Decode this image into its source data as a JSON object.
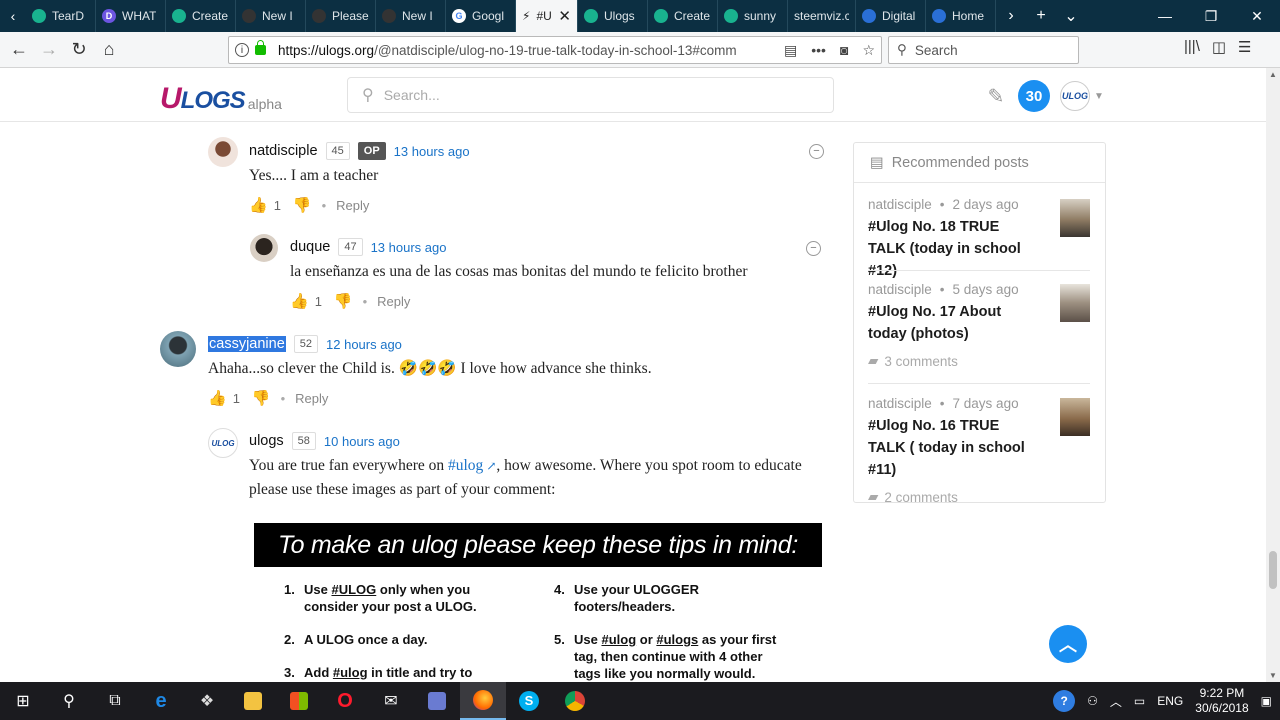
{
  "browser": {
    "tabs": [
      {
        "label": "TearD",
        "color": "#19b38f"
      },
      {
        "label": "WHAT",
        "color": "#6c55e0"
      },
      {
        "label": "Create",
        "color": "#19b38f"
      },
      {
        "label": "New I",
        "color": "#222222"
      },
      {
        "label": "Please",
        "color": "#222222"
      },
      {
        "label": "New I",
        "color": "#222222"
      },
      {
        "label": "Googl",
        "color": "#4285f4"
      },
      {
        "label": "#U",
        "color": "#333333",
        "active": true
      },
      {
        "label": "Ulogs",
        "color": "#19b38f"
      },
      {
        "label": "Create",
        "color": "#19b38f"
      },
      {
        "label": "sunny",
        "color": "#19b38f"
      },
      {
        "label": "steemviz.c",
        "color": "#0c2f42"
      },
      {
        "label": "Digital",
        "color": "#2a6fd6"
      },
      {
        "label": "Home",
        "color": "#2a6fd6"
      }
    ],
    "url_domain": "https://ulogs.org",
    "url_path": "/@natdisciple/ulog-no-19-true-talk-today-in-school-13#comm",
    "search_placeholder": "Search"
  },
  "site": {
    "logo_text": "ULOGS",
    "alpha": "alpha",
    "search_placeholder": "Search...",
    "notifications": "30"
  },
  "comments": [
    {
      "author": "natdisciple",
      "rep": "45",
      "op": "OP",
      "time": "13 hours ago",
      "body": "Yes.... I am a teacher",
      "likes": "1",
      "reply": "Reply"
    },
    {
      "author": "duque",
      "rep": "47",
      "time": "13 hours ago",
      "body": "la enseñanza es una de las cosas mas bonitas del mundo te felicito brother",
      "likes": "1",
      "reply": "Reply"
    },
    {
      "author": "cassyjanine",
      "rep": "52",
      "time": "12 hours ago",
      "body": "Ahaha...so clever the Child is. 🤣🤣🤣 I love how advance she thinks.",
      "likes": "1",
      "reply": "Reply"
    },
    {
      "author": "ulogs",
      "rep": "58",
      "time": "10 hours ago",
      "body_pre": "You are true fan everywhere on ",
      "body_link": "#ulog",
      "body_post": ", how awesome. Where you spot room to educate please use these images as part of your comment:"
    }
  ],
  "tips": {
    "title": "To make an ulog please keep these tips in mind:",
    "t1_pre": "Use ",
    "t1_u": "#ULOG",
    "t1_post": " only when you consider your post a ULOG.",
    "t2": "A ULOG once a day.",
    "t3_pre": "Add ",
    "t3_u": "#ulog",
    "t3_post": " in title and try to number",
    "t4": "Use your ULOGGER footers/headers.",
    "t5_pre": "Use ",
    "t5_u1": "#ulog",
    "t5_mid": " or ",
    "t5_u2": "#ulogs",
    "t5_post": " as your first tag, then continue with 4 other tags like you normally would."
  },
  "sidebar": {
    "heading": "Recommended posts",
    "posts": [
      {
        "author": "natdisciple",
        "time": "2 days ago",
        "title": "#Ulog No. 18 TRUE TALK (today in school #12)"
      },
      {
        "author": "natdisciple",
        "time": "5 days ago",
        "title": "#Ulog No. 17 About today (photos)",
        "comments": "3 comments"
      },
      {
        "author": "natdisciple",
        "time": "7 days ago",
        "title": "#Ulog No. 16 TRUE TALK ( today in school #11)",
        "comments": "2 comments"
      }
    ]
  },
  "taskbar": {
    "lang": "ENG",
    "time": "9:22 PM",
    "date": "30/6/2018"
  }
}
